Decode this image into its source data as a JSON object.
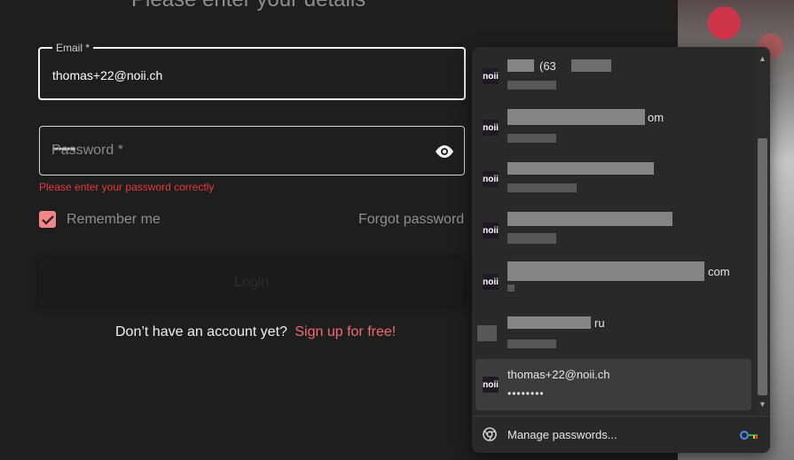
{
  "form": {
    "heading": "Please enter your details",
    "email_label": "Email *",
    "email_value": "thomas+22@noii.ch",
    "password_label": "Password *",
    "password_dots": "••••••••",
    "password_error": "Please enter your password correctly",
    "remember_label": "Remember me",
    "remember_checked": true,
    "forgot_label": "Forgot password",
    "login_label": "Login",
    "signup_prompt": "Don’t have an account yet?",
    "signup_link": "Sign up for free!"
  },
  "popup": {
    "entries": [
      {
        "icon": "noii",
        "title_visible": "(63",
        "redacted": true
      },
      {
        "icon": "noii",
        "title_visible": "om",
        "redacted": true
      },
      {
        "icon": "noii",
        "title_visible": "",
        "redacted": true
      },
      {
        "icon": "noii",
        "title_visible": "",
        "redacted": true
      },
      {
        "icon": "noii",
        "title_visible": "com",
        "redacted": true
      },
      {
        "icon": "",
        "title_visible": "ru",
        "redacted": true
      },
      {
        "icon": "noii",
        "title": "thomas+22@noii.ch",
        "subtitle": "••••••••",
        "redacted": false,
        "selected": true
      }
    ],
    "manage_label": "Manage passwords...",
    "colors": {
      "background": "#292929",
      "selected": "#3c3c3c"
    }
  },
  "colors": {
    "page_bg": "#1e1e1e",
    "accent": "#f26b6f",
    "error": "#e5393a",
    "checkbox": "#f0868a"
  }
}
